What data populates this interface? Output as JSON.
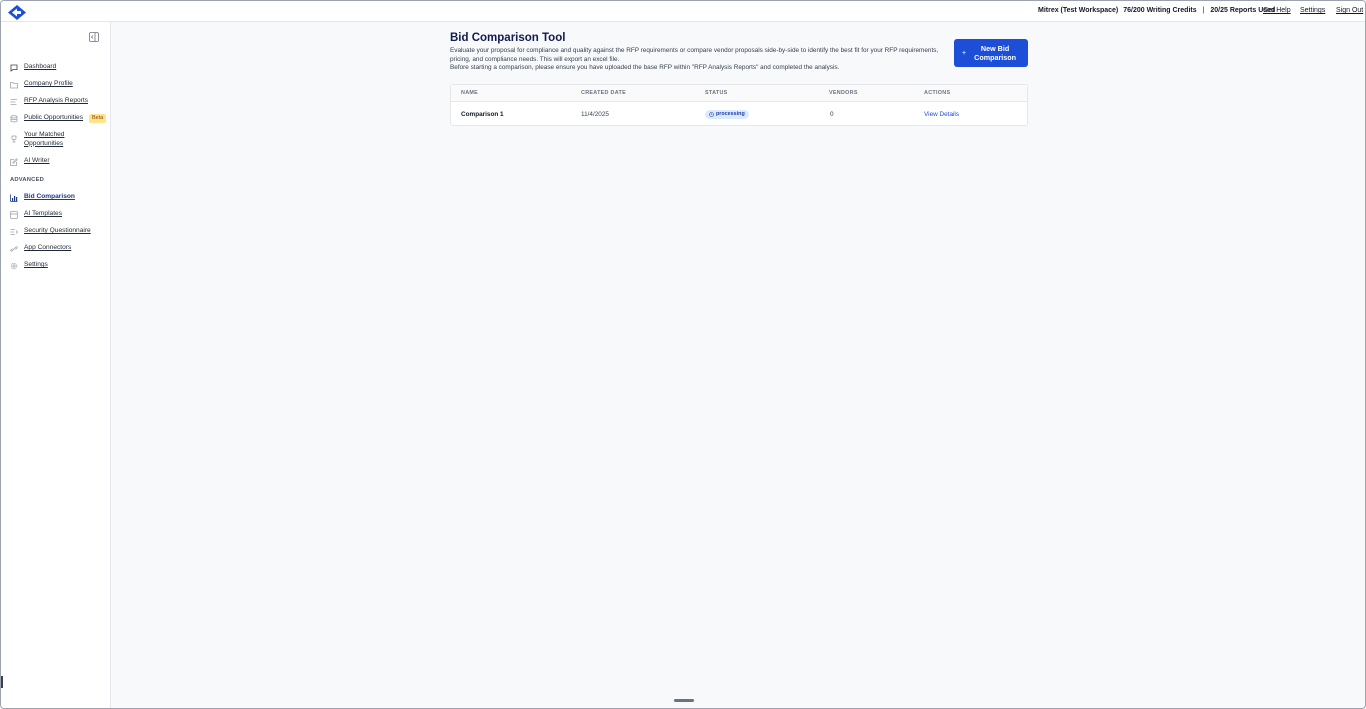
{
  "topbar": {
    "workspace": "Mitrex (Test Workspace)",
    "credits": "76/200 Writing Credits",
    "separator": "|",
    "reports": "20/25 Reports Used",
    "links": [
      "Get Help",
      "Settings",
      "Sign Out"
    ]
  },
  "sidebar": {
    "items": [
      {
        "label": "Dashboard",
        "icon": "chat-bubble-icon"
      },
      {
        "label": "Company Profile",
        "icon": "folder-icon"
      },
      {
        "label": "RFP Analysis Reports",
        "icon": "list-icon"
      },
      {
        "label": "Public Opportunities",
        "icon": "database-icon",
        "badge": "Beta"
      },
      {
        "label": "Your Matched Opportunities",
        "icon": "trophy-icon"
      },
      {
        "label": "AI Writer",
        "icon": "pencil-icon"
      }
    ],
    "section_label": "ADVANCED",
    "advanced_items": [
      {
        "label": "Bid Comparison",
        "icon": "bar-chart-icon",
        "active": true
      },
      {
        "label": "AI Templates",
        "icon": "template-icon"
      },
      {
        "label": "Security Questionnaire",
        "icon": "shield-icon"
      },
      {
        "label": "App Connectors",
        "icon": "link-icon"
      },
      {
        "label": "Settings",
        "icon": "gear-icon"
      }
    ]
  },
  "main": {
    "title": "Bid Comparison Tool",
    "description_line1": "Evaluate your proposal for compliance and quality against the RFP requirements or compare vendor proposals side-by-side to identify the best fit for your RFP requirements, pricing, and compliance needs. This will export an excel file.",
    "description_line2": "Before starting a comparison, please ensure you have uploaded the base RFP within \"RFP Analysis Reports\" and completed the analysis.",
    "new_button": {
      "plus": "+",
      "label": "New Bid Comparison"
    },
    "table": {
      "columns": [
        "NAME",
        "CREATED DATE",
        "STATUS",
        "VENDORS",
        "ACTIONS"
      ],
      "rows": [
        {
          "name": "Comparison 1",
          "created": "11/4/2025",
          "status": "processing",
          "vendors": "0",
          "action": "View Details"
        }
      ]
    }
  },
  "colors": {
    "accent": "#1d4ed8",
    "badge_bg": "#dbeafe",
    "beta_bg": "#fde68a",
    "title": "#111b4d"
  }
}
